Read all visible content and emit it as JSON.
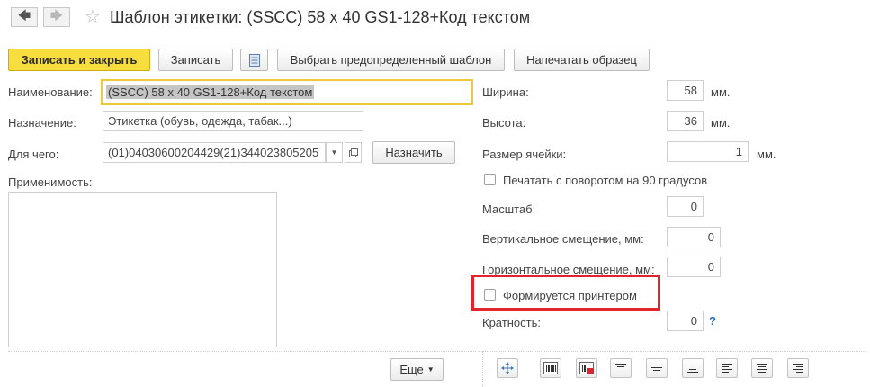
{
  "window": {
    "title": "Шаблон этикетки: (SSCC) 58 х 40 GS1-128+Код текстом",
    "nav": {
      "back_icon": "arrow-left-icon",
      "forward_icon": "arrow-right-icon",
      "favorite_icon": "star-icon"
    }
  },
  "toolbar": {
    "save_close": "Записать и закрыть",
    "save": "Записать",
    "list_icon": "list-icon",
    "choose_template": "Выбрать предопределенный шаблон",
    "print_sample": "Напечатать образец"
  },
  "form": {
    "name_label": "Наименование:",
    "name_value": "(SSCC) 58 х 40 GS1-128+Код текстом",
    "purpose_label": "Назначение:",
    "purpose_value": "Этикетка (обувь, одежда, табак...)",
    "for_what_label": "Для чего:",
    "for_what_value": "(01)04030600204429(21)344023805205",
    "assign_button": "Назначить",
    "applicability_label": "Применимость:",
    "applicability_value": ""
  },
  "params": {
    "width_label": "Ширина:",
    "width_value": "58",
    "width_unit": "мм.",
    "height_label": "Высота:",
    "height_value": "36",
    "height_unit": "мм.",
    "cell_label": "Размер ячейки:",
    "cell_value": "1",
    "cell_unit": "мм.",
    "rotate_label": "Печатать с поворотом на 90 градусов",
    "rotate_checked": false,
    "scale_label": "Масштаб:",
    "scale_value": "0",
    "vshift_label": "Вертикальное смещение, мм:",
    "vshift_value": "0",
    "hshift_label": "Горизонтальное смещение, мм:",
    "hshift_value": "0",
    "printer_label": "Формируется принтером",
    "printer_checked": false,
    "multiplicity_label": "Кратность:",
    "multiplicity_value": "0",
    "help": "?"
  },
  "bottom": {
    "more_button": "Еще",
    "tools": [
      "move-icon",
      "barcode-icon",
      "barcode-delete-icon",
      "align-top-icon",
      "align-middle-icon",
      "align-bottom-icon",
      "align-left-icon",
      "align-center-icon",
      "align-right-icon"
    ]
  },
  "colors": {
    "accent": "#f7dd3e",
    "highlight_border": "#e0262c",
    "link": "#1e6fc1"
  }
}
